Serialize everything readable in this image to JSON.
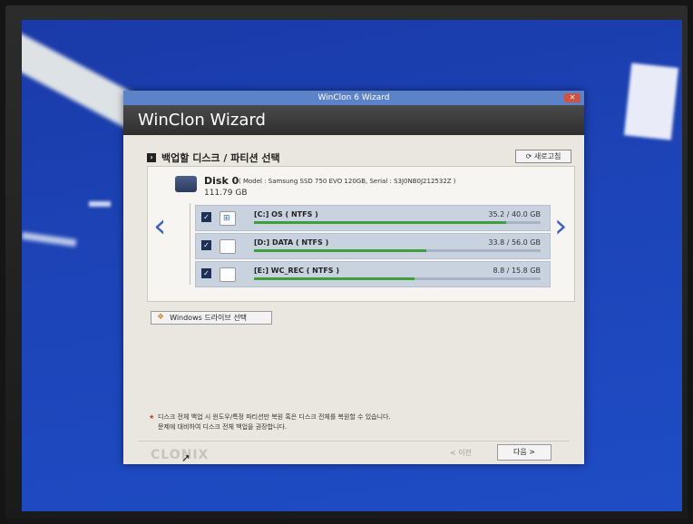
{
  "window": {
    "title": "WinClon 6 Wizard",
    "close_glyph": "✕",
    "header": "WinClon Wizard"
  },
  "section": {
    "title": "백업할 디스크 / 파티션 선택",
    "refresh_label": "새로고침"
  },
  "disk": {
    "name": "Disk 0",
    "model": "( Model : Samsung SSD 750 EVO 120GB, Serial : S3J0NB0J212532Z )",
    "size": "111.79 GB"
  },
  "partitions": [
    {
      "name": "[C:] OS ( NTFS )",
      "size": "35.2 / 40.0 GB",
      "used_fraction": 0.88,
      "icon": "windows-drive-icon"
    },
    {
      "name": "[D:] DATA ( NTFS )",
      "size": "33.8 / 56.0 GB",
      "used_fraction": 0.6,
      "icon": "drive-icon"
    },
    {
      "name": "[E:] WC_REC ( NTFS )",
      "size": "8.8 / 15.8 GB",
      "used_fraction": 0.56,
      "icon": "drive-icon"
    }
  ],
  "windows_drive_button": "Windows 드라이브 선택",
  "note": {
    "line1": "디스크 전체 백업 시 윈도우/특정 파티션만 복원 혹은 디스크 전체를 복원할 수 있습니다.",
    "line2": "문제에 대비하여 디스크 전체 백업을 권장합니다."
  },
  "footer": {
    "logo": "CLONIX",
    "prev_label": "< 이전",
    "next_label": "다음 >"
  },
  "colors": {
    "screen_bg": "#1d44b8",
    "titlebar": "#5c82c8",
    "progress_fill": "#3f9f3a",
    "partition_bg": "#c9d3e0"
  }
}
